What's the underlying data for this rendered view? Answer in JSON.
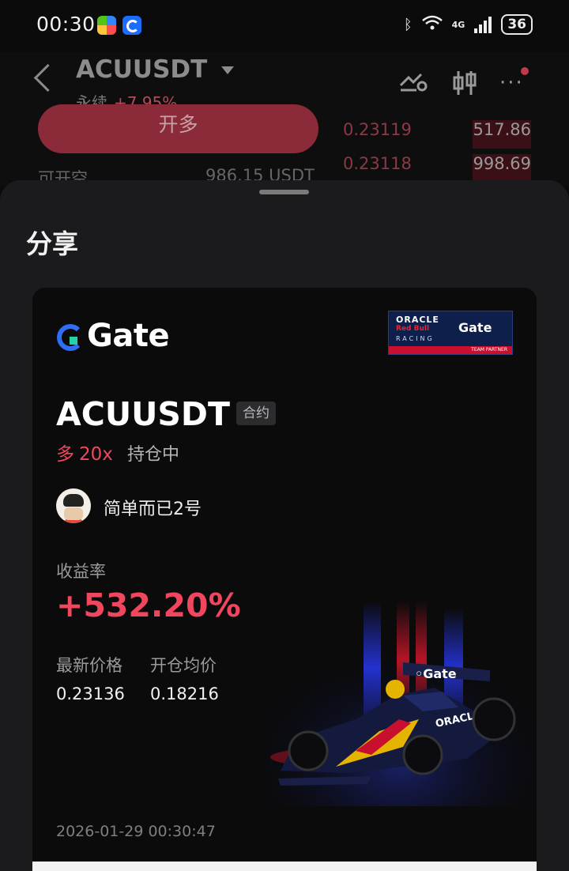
{
  "status_bar": {
    "time": "00:30",
    "network": "4G",
    "battery": "36"
  },
  "header": {
    "pair": "ACUUSDT",
    "type": "永续",
    "change": "+7.95%",
    "long_button": "开多",
    "available_label": "可开空",
    "available_value": "986.15 USDT"
  },
  "order_book": [
    {
      "price": "0.23119",
      "qty": "517.86"
    },
    {
      "price": "0.23118",
      "qty": "998.69"
    }
  ],
  "sheet": {
    "title": "分享"
  },
  "card": {
    "logo": "Gate",
    "partner": {
      "line1": "ORACLE",
      "line2": "Red Bull",
      "line3": "RACING",
      "brand": "Gate",
      "footer": "TEAM PARTNER"
    },
    "pair": "ACUUSDT",
    "tag": "合约",
    "direction": "多",
    "leverage": "20x",
    "position_status": "持仓中",
    "username": "简单而已2号",
    "yield_label": "收益率",
    "yield_value": "+532.20%",
    "latest_price_label": "最新价格",
    "latest_price": "0.23136",
    "open_avg_label": "开仓均价",
    "open_avg": "0.18216",
    "timestamp": "2026-01-29 00:30:47"
  },
  "colors": {
    "profit": "#f0465e",
    "sheet_bg": "#1b1b1d",
    "card_bg": "#0b0b0c",
    "gate_blue": "#2f6df6"
  }
}
